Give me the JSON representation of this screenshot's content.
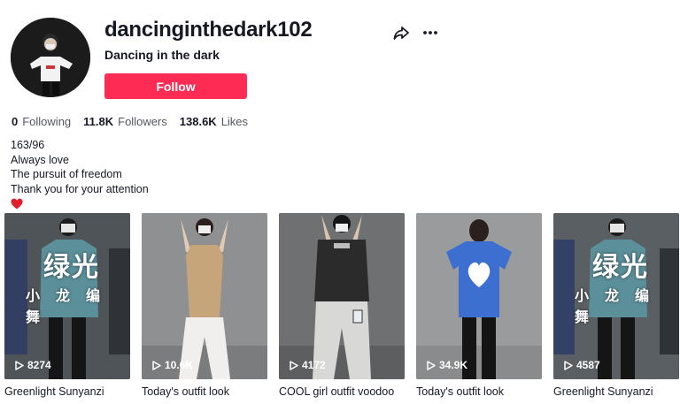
{
  "profile": {
    "username": "dancinginthedark102",
    "nickname": "Dancing in the dark",
    "follow_label": "Follow",
    "stats": [
      {
        "value": "0",
        "label": "Following"
      },
      {
        "value": "11.8K",
        "label": "Followers"
      },
      {
        "value": "138.6K",
        "label": "Likes"
      }
    ],
    "bio": [
      "163/96",
      "Always love",
      "The pursuit of freedom",
      "Thank you for your attention"
    ]
  },
  "icons": {
    "share": "share-icon",
    "more": "more-icon",
    "heart": "heart-emoji-icon",
    "play": "play-icon"
  },
  "colors": {
    "follow": "#fe2c55",
    "text": "#161823",
    "secondary_text": "#555760",
    "heart": "#e0202f",
    "shirt_blue": "#3d6fd1",
    "shirt_teal": "#5b8f9a"
  },
  "videos": [
    {
      "views": "8274",
      "caption": "Greenlight Sunyanzi",
      "overlay_big": "绿光",
      "overlay_small": "小龙编舞"
    },
    {
      "views": "10.6K",
      "caption": "Today's outfit look"
    },
    {
      "views": "4172",
      "caption": "COOL girl outfit voodoo"
    },
    {
      "views": "34.9K",
      "caption": "Today's outfit look"
    },
    {
      "views": "4587",
      "caption": "Greenlight Sunyanzi",
      "overlay_big": "绿光",
      "overlay_small": "小龙编舞"
    }
  ]
}
